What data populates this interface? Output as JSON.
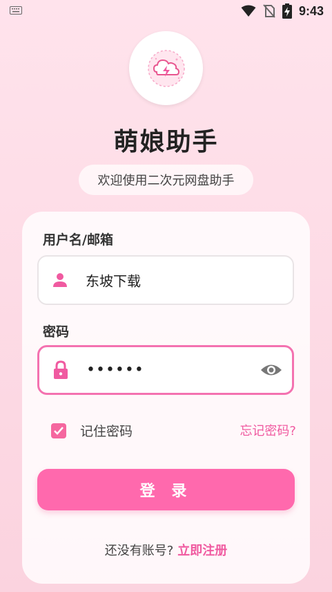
{
  "status_bar": {
    "time": "9:43",
    "icons": [
      "keyboard-icon",
      "wifi-icon",
      "no-sim-icon",
      "battery-charging-icon"
    ]
  },
  "app": {
    "title": "萌娘助手",
    "subtitle": "欢迎使用二次元网盘助手",
    "logo_icon": "storm-cloud-icon"
  },
  "form": {
    "username_label": "用户名/邮箱",
    "username_value": "东坡下载",
    "username_icon": "person-icon",
    "password_label": "密码",
    "password_value": "••••••",
    "password_icon": "lock-icon",
    "password_visibility_icon": "eye-icon",
    "remember_checked": true,
    "remember_label": "记住密码",
    "forgot_label": "忘记密码?",
    "login_button": "登 录",
    "no_account_text": "还没有账号?",
    "register_link": "立即注册"
  },
  "colors": {
    "accent": "#ff69ad",
    "link": "#f05aa0",
    "background_top": "#ffe3ec",
    "background_bottom": "#fbd3df"
  }
}
